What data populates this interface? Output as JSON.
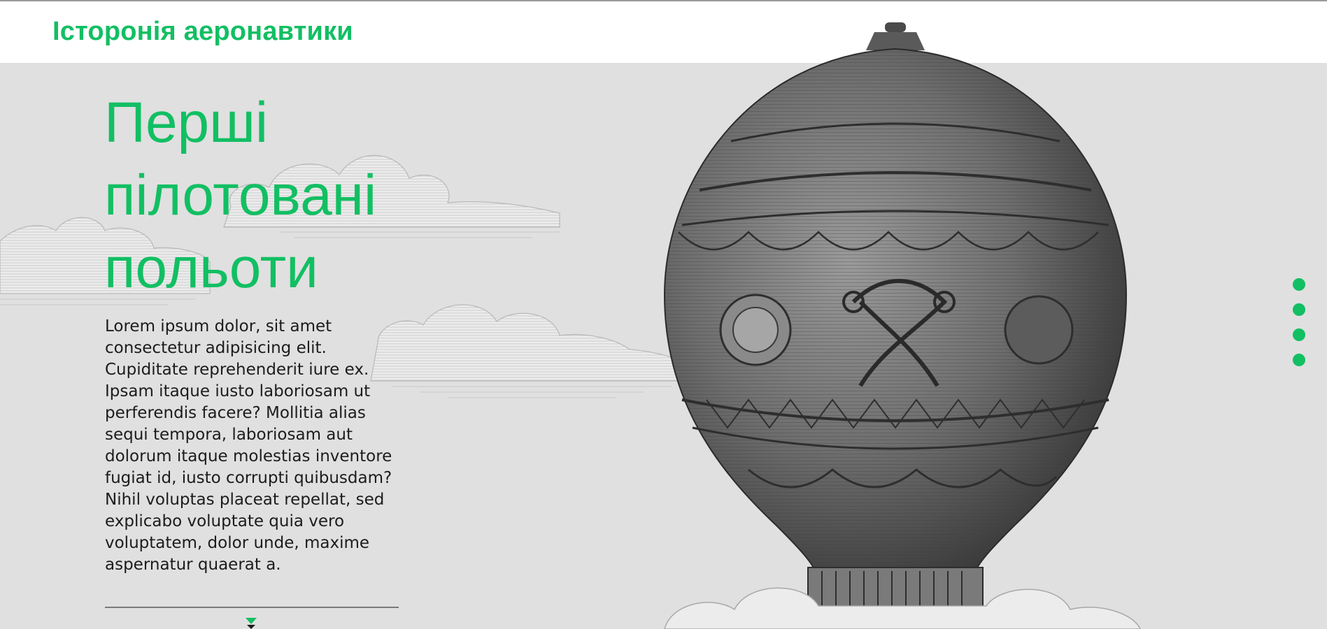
{
  "header": {
    "site_title": "Історонія аеронавтики"
  },
  "hero": {
    "title": "Перші пілотовані польоти",
    "body": "Lorem ipsum dolor, sit amet consectetur adipisicing elit. Cupiditate reprehenderit iure ex. Ipsam itaque iusto laboriosam ut perferendis facere? Mollitia alias sequi tempora, laboriosam aut dolorum itaque molestias inventore fugiat id, iusto corrupti quibusdam? Nihil voluptas placeat repellat, sed explicabo voluptate quia vero voluptatem, dolor unde, maxime aspernatur quaerat a."
  },
  "slider": {
    "dot_count": 4
  },
  "colors": {
    "accent": "#12bf63",
    "background": "#e0e0e0",
    "header_background": "#ffffff",
    "text": "#1c1c1c"
  },
  "icons": {
    "scroll": "scroll-down-icon",
    "artwork": "hot-air-balloon-engraving"
  }
}
